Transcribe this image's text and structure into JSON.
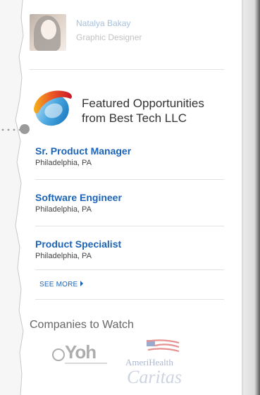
{
  "profile": {
    "name": "Natalya Bakay",
    "title": "Graphic Designer"
  },
  "featured": {
    "line1": "Featured Opportunities",
    "line2": "from Best Tech LLC"
  },
  "jobs": [
    {
      "title": "Sr. Product Manager",
      "location": "Philadelphia, PA"
    },
    {
      "title": "Software Engineer",
      "location": "Philadelphia, PA"
    },
    {
      "title": "Product Specialist",
      "location": "Philadelphia, PA"
    }
  ],
  "see_more_label": "SEE MORE",
  "companies": {
    "heading": "Companies to Watch",
    "yoh": "Yoh",
    "ameri_line1": "AmeriHealth",
    "ameri_line2": "Caritas"
  },
  "colors": {
    "link": "#1b64b8",
    "heading_text": "#333333"
  }
}
